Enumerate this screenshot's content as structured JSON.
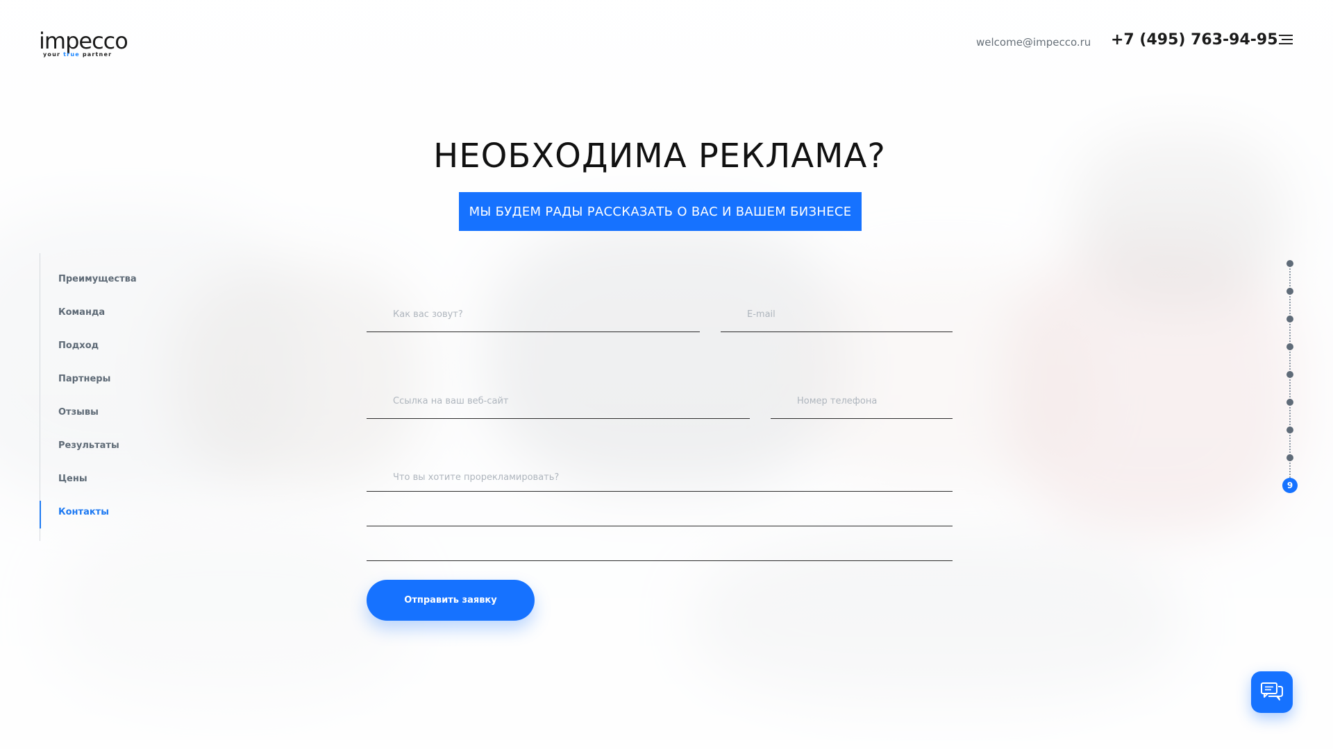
{
  "header": {
    "logo_text": "impecco",
    "logo_tagline_1": "your",
    "logo_tagline_2": "true",
    "logo_tagline_3": "partner",
    "email": "welcome@impecco.ru",
    "phone": "+7 (495) 763-94-95",
    "menu_icon": "hamburger-icon"
  },
  "hero": {
    "title": "НЕОБХОДИМА РЕКЛАМА?",
    "subtitle": "МЫ БУДЕМ РАДЫ РАССКАЗАТЬ О ВАС И ВАШЕМ БИЗНЕСЕ"
  },
  "sidebar": {
    "items": [
      {
        "label": "Преимущества"
      },
      {
        "label": "Команда"
      },
      {
        "label": "Подход"
      },
      {
        "label": "Партнеры"
      },
      {
        "label": "Отзывы"
      },
      {
        "label": "Результаты"
      },
      {
        "label": "Цены"
      },
      {
        "label": "Контакты",
        "active": true
      }
    ]
  },
  "pager": {
    "current": "9",
    "total_dots": 9
  },
  "form": {
    "name_placeholder": "Как вас зовут?",
    "email_placeholder": "E-mail",
    "website_placeholder": "Ссылка на ваш веб-сайт",
    "phone_placeholder": "Номер телефона",
    "message_placeholder": "Что вы хотите прорекламировать?",
    "submit_label": "Отправить заявку"
  },
  "chat": {
    "icon": "chat-bubbles-icon"
  },
  "colors": {
    "accent": "#1672ff",
    "nav_text": "#5e6a76",
    "nav_active": "#1d79f2"
  }
}
